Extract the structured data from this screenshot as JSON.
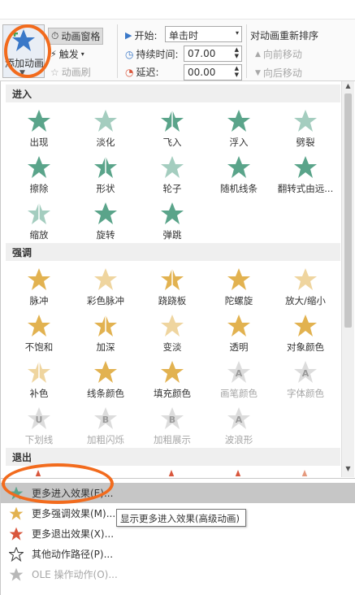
{
  "ribbon": {
    "add_animation_label": "添加动画",
    "animation_pane_label": "动画窗格",
    "trigger_label": "触发",
    "animation_painter_label": "动画刷",
    "start_label": "开始:",
    "start_value": "单击时",
    "duration_label": "持续时间:",
    "duration_value": "07.00",
    "delay_label": "延迟:",
    "delay_value": "00.00",
    "reorder_title": "对动画重新排序",
    "move_earlier_label": "向前移动",
    "move_later_label": "向后移动"
  },
  "sections": {
    "entrance": "进入",
    "emphasis": "强调",
    "exit": "退出"
  },
  "entrance_effects": [
    {
      "label": "出现",
      "icon": "star-appear-icon"
    },
    {
      "label": "淡化",
      "icon": "star-fade-icon"
    },
    {
      "label": "飞入",
      "icon": "star-fly-in-icon"
    },
    {
      "label": "浮入",
      "icon": "star-float-in-icon"
    },
    {
      "label": "劈裂",
      "icon": "star-split-icon"
    },
    {
      "label": "擦除",
      "icon": "star-wipe-icon"
    },
    {
      "label": "形状",
      "icon": "star-shape-icon"
    },
    {
      "label": "轮子",
      "icon": "star-wheel-icon"
    },
    {
      "label": "随机线条",
      "icon": "star-random-bars-icon"
    },
    {
      "label": "翻转式由远...",
      "icon": "star-grow-turn-icon"
    },
    {
      "label": "缩放",
      "icon": "star-zoom-icon"
    },
    {
      "label": "旋转",
      "icon": "star-swivel-icon"
    },
    {
      "label": "弹跳",
      "icon": "star-bounce-icon"
    }
  ],
  "emphasis_effects": [
    {
      "label": "脉冲",
      "icon": "star-pulse-icon",
      "enabled": true
    },
    {
      "label": "彩色脉冲",
      "icon": "star-color-pulse-icon",
      "enabled": true
    },
    {
      "label": "跷跷板",
      "icon": "star-teeter-icon",
      "enabled": true
    },
    {
      "label": "陀螺旋",
      "icon": "star-spin-icon",
      "enabled": true
    },
    {
      "label": "放大/缩小",
      "icon": "star-grow-shrink-icon",
      "enabled": true
    },
    {
      "label": "不饱和",
      "icon": "star-desaturate-icon",
      "enabled": true
    },
    {
      "label": "加深",
      "icon": "star-darken-icon",
      "enabled": true
    },
    {
      "label": "变淡",
      "icon": "star-lighten-icon",
      "enabled": true
    },
    {
      "label": "透明",
      "icon": "star-transparency-icon",
      "enabled": true
    },
    {
      "label": "对象颜色",
      "icon": "star-object-color-icon",
      "enabled": true
    },
    {
      "label": "补色",
      "icon": "star-complementary-color-icon",
      "enabled": true
    },
    {
      "label": "线条颜色",
      "icon": "star-line-color-icon",
      "enabled": true
    },
    {
      "label": "填充颜色",
      "icon": "star-fill-color-icon",
      "enabled": true
    },
    {
      "label": "画笔颜色",
      "icon": "brush-color-icon",
      "enabled": false,
      "glyph": "A"
    },
    {
      "label": "字体颜色",
      "icon": "font-color-icon",
      "enabled": false,
      "glyph": "A"
    },
    {
      "label": "下划线",
      "icon": "underline-icon",
      "enabled": false,
      "glyph": "U"
    },
    {
      "label": "加粗闪烁",
      "icon": "bold-flash-icon",
      "enabled": false,
      "glyph": "B"
    },
    {
      "label": "加粗展示",
      "icon": "bold-reveal-icon",
      "enabled": false,
      "glyph": "B"
    },
    {
      "label": "波浪形",
      "icon": "wave-icon",
      "enabled": false,
      "glyph": "A"
    }
  ],
  "menu": [
    {
      "label": "更多进入效果(E)...",
      "icon": "green-star-icon"
    },
    {
      "label": "更多强调效果(M)...",
      "icon": "yellow-star-icon"
    },
    {
      "label": "更多退出效果(X)...",
      "icon": "red-star-icon"
    },
    {
      "label": "其他动作路径(P)...",
      "icon": "outline-star-icon"
    },
    {
      "label": "OLE 操作动作(O)...",
      "icon": "ole-gear-icon"
    }
  ],
  "tooltip": "显示更多进入效果(高级动画)",
  "colors": {
    "entrance_green": "#5aa48a",
    "emphasis_gold": "#e2b250",
    "exit_red": "#d9573d",
    "annotation_orange": "#f26b1d",
    "ribbon_blue": "#3a78c8"
  }
}
